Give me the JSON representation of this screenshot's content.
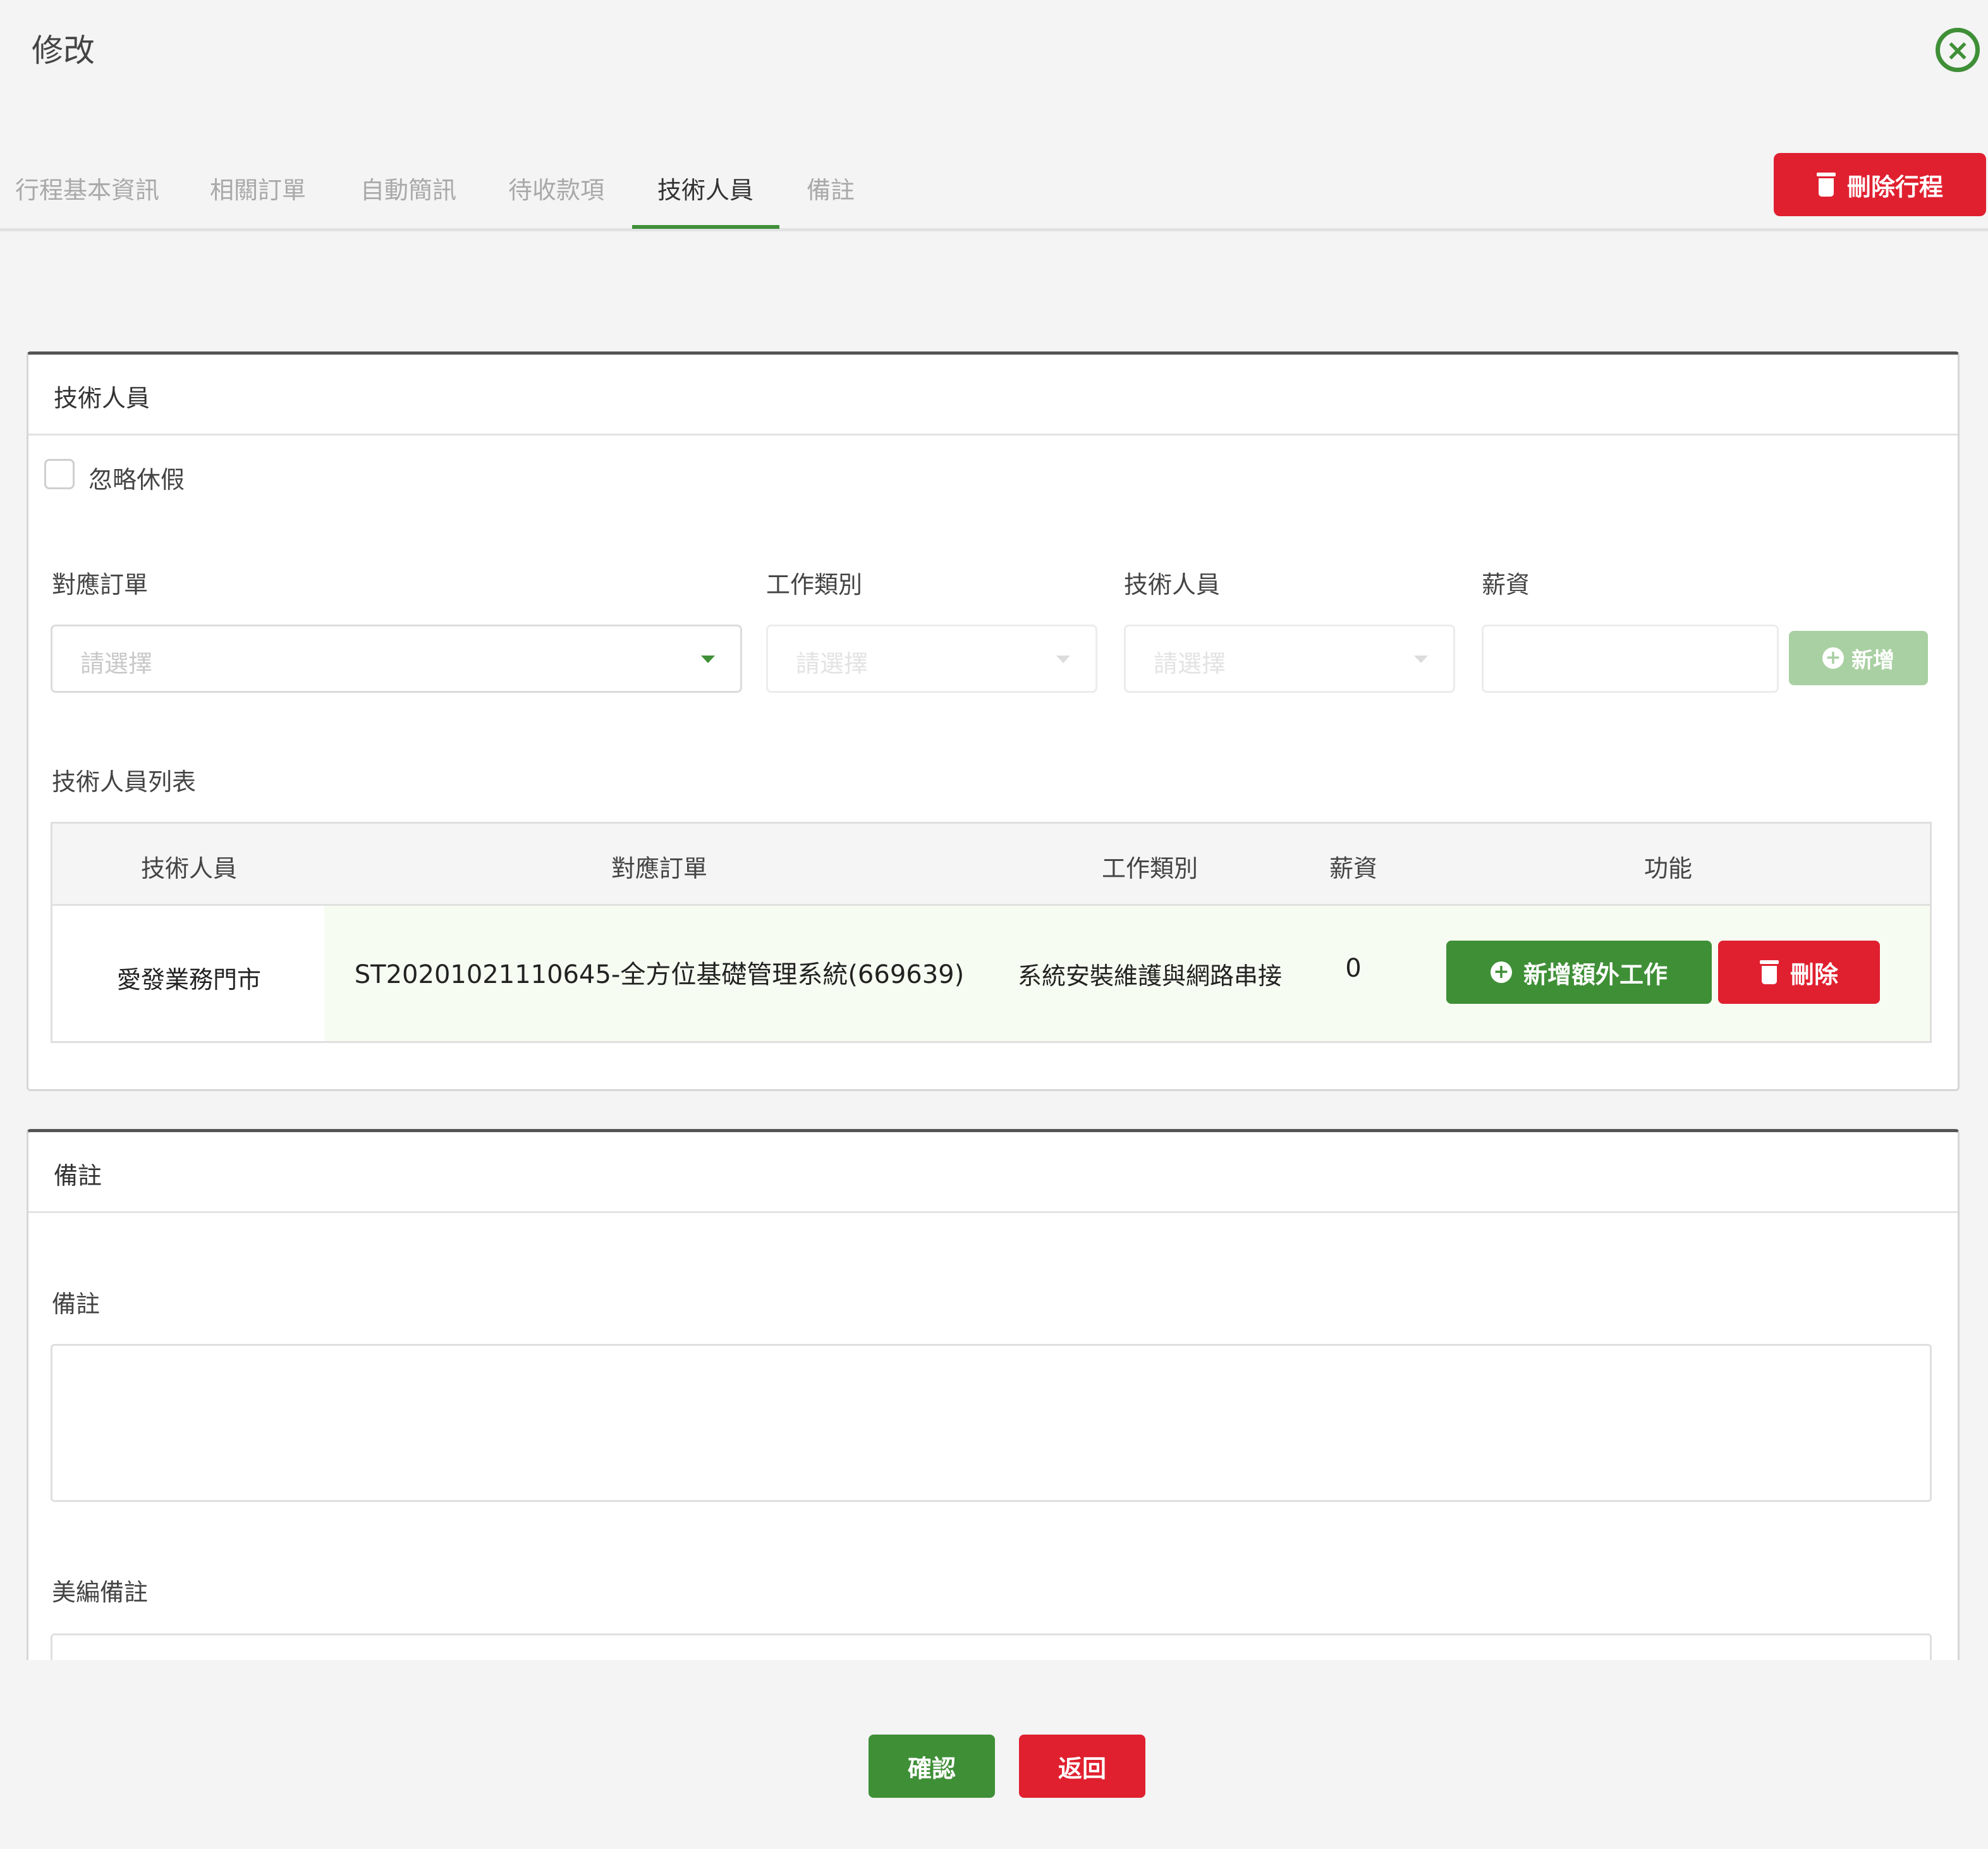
{
  "header": {
    "title": "修改",
    "close_icon": "close-circle-icon"
  },
  "tabs": [
    {
      "label": "行程基本資訊",
      "active": false
    },
    {
      "label": "相關訂單",
      "active": false
    },
    {
      "label": "自動簡訊",
      "active": false
    },
    {
      "label": "待收款項",
      "active": false
    },
    {
      "label": "技術人員",
      "active": true
    },
    {
      "label": "備註",
      "active": false
    }
  ],
  "delete_trip_label": "刪除行程",
  "technicians_panel": {
    "title": "技術人員",
    "ignore_leave_label": "忽略休假",
    "ignore_leave_checked": false,
    "fields": {
      "order_label": "對應訂單",
      "order_placeholder": "請選擇",
      "work_type_label": "工作類別",
      "work_type_placeholder": "請選擇",
      "technician_label": "技術人員",
      "technician_placeholder": "請選擇",
      "salary_label": "薪資",
      "salary_value": ""
    },
    "add_label": "新增",
    "list_title": "技術人員列表",
    "columns": [
      "技術人員",
      "對應訂單",
      "工作類別",
      "薪資",
      "功能"
    ],
    "rows": [
      {
        "technician": "愛發業務門市",
        "order": "ST20201021110645-全方位基礎管理系統(669639)",
        "work_type": "系統安裝維護與網路串接",
        "salary": "0",
        "extra_work_label": "新增額外工作",
        "delete_label": "刪除"
      }
    ]
  },
  "notes_panel": {
    "title": "備註",
    "note_label": "備註",
    "note_value": "",
    "editor_note_label": "美編備註",
    "editor_note_value": ""
  },
  "footer": {
    "confirm_label": "確認",
    "back_label": "返回"
  },
  "colors": {
    "primary_green": "#3f8f37",
    "danger_red": "#e0202f",
    "disabled_green": "#a9d0a2"
  }
}
